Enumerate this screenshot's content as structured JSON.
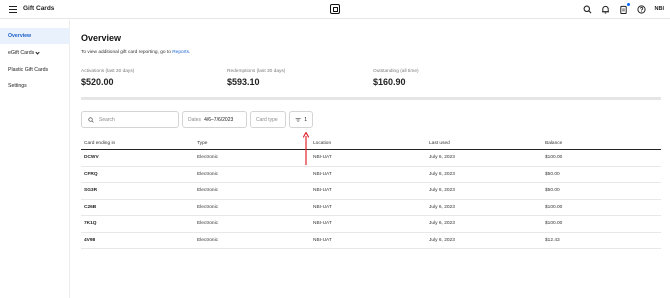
{
  "header": {
    "title": "Gift Cards",
    "logo_icon": "square-logo-icon",
    "initials": "NBI"
  },
  "sidebar": {
    "items": [
      {
        "label": "Overview",
        "active": true
      },
      {
        "label": "eGift Cards",
        "active": false
      },
      {
        "label": "Plastic Gift Cards",
        "active": false
      },
      {
        "label": "Settings",
        "active": false
      }
    ]
  },
  "main": {
    "title": "Overview",
    "report_note": "To view additional gift card reporting, go to",
    "report_link": "Reports",
    "report_suffix": ".",
    "stats": [
      {
        "label": "Activations (last 30 days)",
        "value": "$520.00"
      },
      {
        "label": "Redemptions (last 30 days)",
        "value": "$593.10"
      },
      {
        "label": "Outstanding (all time)",
        "value": "$160.90"
      }
    ]
  },
  "filters": {
    "search_placeholder": "Search",
    "dates_label": "Dates",
    "dates_value": "4/6–7/6/2023",
    "card_type_label": "Card type",
    "filter_count": "1"
  },
  "table": {
    "columns": [
      "Card ending in",
      "Type",
      "Location",
      "Last used",
      "Balance"
    ],
    "rows": [
      [
        "DCWV",
        "Electronic",
        "NBI-UAT",
        "July 6, 2023",
        "$100.00"
      ],
      [
        "CFRQ",
        "Electronic",
        "NBI-UAT",
        "July 6, 2023",
        "$50.00"
      ],
      [
        "SG3R",
        "Electronic",
        "NBI-UAT",
        "July 6, 2023",
        "$50.00"
      ],
      [
        "C26B",
        "Electronic",
        "NBI-UAT",
        "July 6, 2023",
        "$100.00"
      ],
      [
        "7K1Q",
        "Electronic",
        "NBI-UAT",
        "July 6, 2023",
        "$100.00"
      ],
      [
        "4V98",
        "Electronic",
        "NBI-UAT",
        "July 6, 2023",
        "$12.43"
      ]
    ]
  },
  "colors": {
    "accent": "#1a66d2",
    "active_bg": "#e9f1fc",
    "annotation_arrow": "#e0242b"
  }
}
